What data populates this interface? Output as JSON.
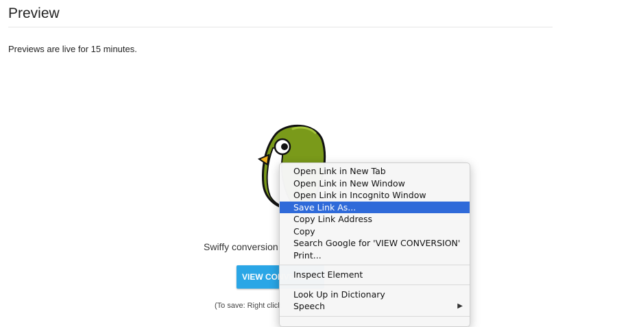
{
  "page": {
    "title": "Preview",
    "notice": "Previews are live for 15 minutes.",
    "result_text": "Swiffy conversion",
    "view_button_label": "VIEW CONVERSION",
    "save_hint": "(To save: Right click"
  },
  "context_menu": {
    "groups": [
      [
        {
          "label": "Open Link in New Tab"
        },
        {
          "label": "Open Link in New Window"
        },
        {
          "label": "Open Link in Incognito Window"
        },
        {
          "label": "Save Link As...",
          "selected": true
        },
        {
          "label": "Copy Link Address"
        },
        {
          "label": "Copy"
        },
        {
          "label": "Search Google for 'VIEW CONVERSION'"
        },
        {
          "label": "Print..."
        }
      ],
      [
        {
          "label": "Inspect Element"
        }
      ],
      [
        {
          "label": "Look Up in Dictionary"
        },
        {
          "label": "Speech",
          "submenu_arrow": "▶"
        }
      ]
    ]
  },
  "colors": {
    "accent": "#2aa6e6",
    "menu_highlight": "#2f6ad9",
    "mascot_green": "#7a9a1a"
  },
  "icons": {
    "mascot": "swiffy-bird-icon",
    "submenu": "chevron-right-icon"
  }
}
